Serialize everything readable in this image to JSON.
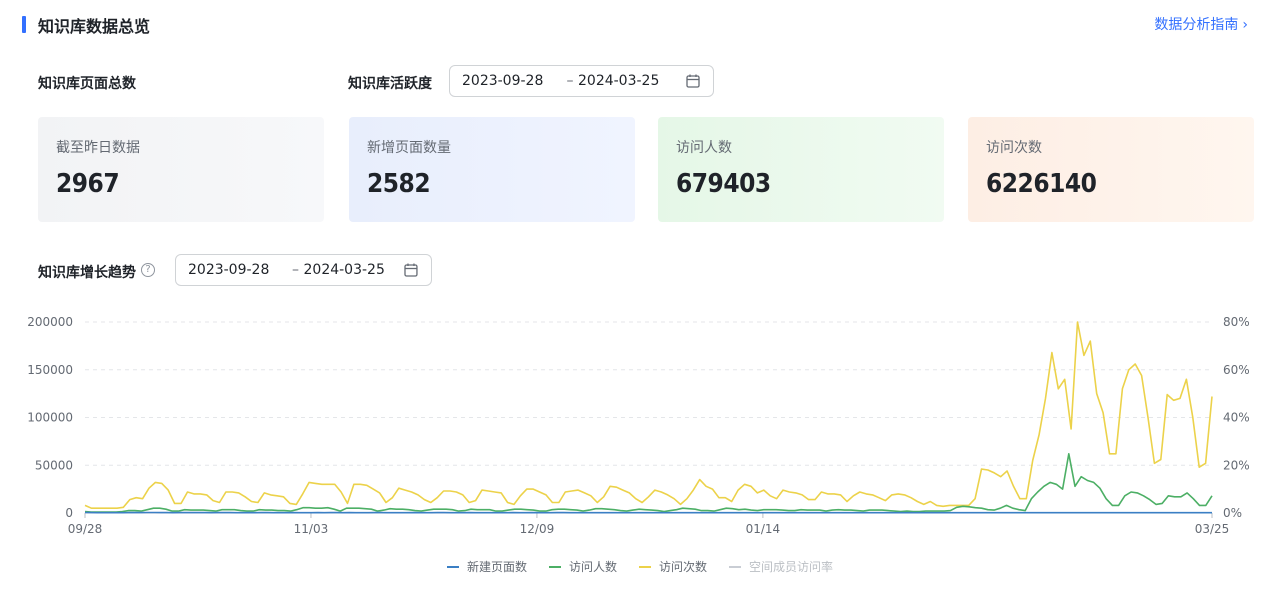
{
  "header": {
    "title": "知识库数据总览",
    "guide_link": "数据分析指南"
  },
  "overview": {
    "total_pages_label": "知识库页面总数",
    "activity_label": "知识库活跃度",
    "range_start": "2023-09-28",
    "range_sep": "–",
    "range_end": "2024-03-25"
  },
  "cards": [
    {
      "label": "截至昨日数据",
      "value": "2967"
    },
    {
      "label": "新增页面数量",
      "value": "2582"
    },
    {
      "label": "访问人数",
      "value": "679403"
    },
    {
      "label": "访问次数",
      "value": "6226140"
    }
  ],
  "trend": {
    "label": "知识库增长趋势",
    "range_start": "2023-09-28",
    "range_sep": "–",
    "range_end": "2024-03-25"
  },
  "legend": [
    {
      "name": "新建页面数",
      "color": "#3b7fc4",
      "active": true
    },
    {
      "name": "访问人数",
      "color": "#4caf65",
      "active": true
    },
    {
      "name": "访问次数",
      "color": "#ecd24a",
      "active": true
    },
    {
      "name": "空间成员访问率",
      "color": "#c9cdd4",
      "active": false
    }
  ],
  "icons": {
    "calendar": "calendar-icon",
    "help": "question-circle-icon",
    "chevron": "chevron-right-icon"
  },
  "chart_data": {
    "type": "line",
    "x_tick_labels": [
      "09/28",
      "11/03",
      "12/09",
      "01/14",
      "03/25"
    ],
    "ylim_left": [
      0,
      200000
    ],
    "yticks_left": [
      "0",
      "50000",
      "100000",
      "150000",
      "200000"
    ],
    "ylim_right": [
      0,
      80
    ],
    "yticks_right": [
      "0%",
      "20%",
      "40%",
      "60%",
      "80%"
    ],
    "grid": true,
    "legend_position": "bottom",
    "series": [
      {
        "name": "新建页面数",
        "color": "#3b7fc4",
        "values": [
          500,
          400,
          300,
          300,
          300,
          300,
          300,
          400,
          500,
          400,
          500,
          500,
          400,
          400,
          300,
          400,
          500,
          400,
          400,
          400,
          300,
          400,
          400,
          400,
          300,
          300,
          400,
          300,
          400,
          400,
          300,
          300,
          300,
          400,
          300,
          300,
          300,
          400,
          300,
          400,
          400,
          300,
          400,
          300,
          300,
          300,
          400,
          400,
          300,
          300,
          300,
          300,
          400,
          300,
          300,
          300,
          400,
          400,
          300,
          300,
          300,
          400,
          300,
          300,
          300,
          300,
          300,
          300,
          400,
          300,
          300,
          400,
          300,
          300,
          300,
          400,
          400,
          300,
          300,
          300,
          300,
          300,
          300,
          300,
          300,
          300,
          300,
          300,
          300,
          300,
          300,
          300,
          300,
          300,
          300,
          300,
          300,
          300,
          300,
          300,
          300,
          300,
          300,
          300,
          300,
          300,
          300,
          300,
          300,
          300,
          300,
          300,
          300,
          300,
          300,
          300,
          300,
          300,
          300,
          300,
          300,
          300,
          300,
          300,
          300,
          300,
          300,
          300,
          300,
          300,
          300,
          300,
          300,
          300,
          300,
          300,
          300,
          300,
          300,
          300,
          300,
          300,
          300,
          300,
          300,
          300,
          300,
          300,
          300,
          300,
          300,
          300,
          300,
          300,
          300,
          300,
          300,
          300,
          300,
          300,
          300,
          300,
          300,
          300,
          300,
          300,
          300,
          300,
          300,
          300,
          300,
          300,
          300,
          300,
          300,
          300,
          300,
          300,
          300,
          300
        ]
      },
      {
        "name": "访问人数",
        "color": "#4caf65",
        "values": [
          1500,
          1000,
          1000,
          1000,
          1000,
          1000,
          1500,
          2500,
          2500,
          2000,
          3500,
          5000,
          5000,
          4000,
          2000,
          2000,
          3500,
          3000,
          3000,
          3000,
          2500,
          2000,
          3500,
          3500,
          3500,
          2500,
          2000,
          2000,
          3500,
          3000,
          3000,
          2500,
          2500,
          2000,
          3500,
          5500,
          5500,
          5000,
          5000,
          5500,
          4000,
          2000,
          5000,
          5000,
          5000,
          4500,
          4000,
          2000,
          3000,
          4500,
          4000,
          4000,
          3500,
          2500,
          2000,
          3000,
          4000,
          4000,
          4000,
          3500,
          2000,
          2500,
          4000,
          3500,
          3500,
          3500,
          2000,
          2000,
          3000,
          4000,
          4000,
          3500,
          3000,
          2000,
          2000,
          3500,
          4000,
          4000,
          3500,
          3000,
          2000,
          3000,
          4500,
          4500,
          4000,
          3500,
          2500,
          2000,
          3000,
          4000,
          3500,
          3000,
          2500,
          1500,
          2500,
          3500,
          5000,
          4500,
          4000,
          2500,
          2500,
          2000,
          3500,
          5000,
          4500,
          3500,
          4000,
          3000,
          2500,
          3500,
          3500,
          3500,
          3000,
          2500,
          2500,
          3500,
          3000,
          3000,
          3000,
          2000,
          3000,
          3500,
          3000,
          3000,
          2500,
          2000,
          3000,
          3000,
          3000,
          2500,
          2000,
          1500,
          2000,
          1500,
          1500,
          2000,
          2000,
          2000,
          2000,
          2500,
          6000,
          7000,
          6500,
          5500,
          5000,
          3500,
          3000,
          5000,
          8000,
          5000,
          3500,
          2500,
          15000,
          22000,
          28000,
          32000,
          30000,
          25000,
          62000,
          28000,
          38000,
          34000,
          32000,
          26000,
          15000,
          8000,
          8000,
          18000,
          22000,
          21000,
          18000,
          14000,
          9000,
          10000,
          18000,
          17000,
          17000,
          21000,
          15000,
          8000,
          8000,
          18000
        ]
      },
      {
        "name": "访问次数",
        "color": "#ecd24a",
        "values": [
          8000,
          5000,
          5000,
          5000,
          5000,
          5000,
          6000,
          14000,
          16000,
          15000,
          26000,
          32000,
          31000,
          24000,
          10000,
          10000,
          22000,
          20000,
          20000,
          19000,
          13000,
          11000,
          22000,
          22000,
          21000,
          17000,
          12000,
          11000,
          21000,
          19000,
          18000,
          17000,
          10000,
          9000,
          20000,
          32000,
          31000,
          30000,
          30000,
          30000,
          22000,
          10000,
          30000,
          30000,
          29000,
          25000,
          21000,
          11000,
          16000,
          26000,
          24000,
          22000,
          19000,
          14000,
          11000,
          16000,
          23000,
          23000,
          22000,
          19000,
          11000,
          13000,
          24000,
          23000,
          22000,
          21000,
          11000,
          9000,
          18000,
          25000,
          25000,
          22000,
          19000,
          11000,
          11000,
          22000,
          23000,
          24000,
          21000,
          18000,
          11000,
          17000,
          28000,
          27000,
          24000,
          21000,
          15000,
          11000,
          17000,
          24000,
          22000,
          19000,
          15000,
          9000,
          15000,
          24000,
          35000,
          28000,
          25000,
          16000,
          16000,
          12000,
          24000,
          30000,
          28000,
          21000,
          24000,
          18000,
          15000,
          24000,
          22000,
          21000,
          19000,
          14000,
          14000,
          22000,
          20000,
          20000,
          19000,
          12000,
          18000,
          22000,
          20000,
          19000,
          16000,
          13000,
          19000,
          20000,
          19000,
          16000,
          12000,
          9000,
          12000,
          8000,
          7000,
          8000,
          8000,
          8000,
          8000,
          15000,
          46000,
          45000,
          42000,
          38000,
          44000,
          28000,
          15000,
          15000,
          55000,
          82000,
          120000,
          168000,
          130000,
          140000,
          88000,
          200000,
          165000,
          180000,
          125000,
          105000,
          62000,
          62000,
          130000,
          150000,
          156000,
          144000,
          100000,
          52000,
          56000,
          124000,
          118000,
          120000,
          140000,
          100000,
          48000,
          52000,
          122000
        ]
      }
    ]
  }
}
